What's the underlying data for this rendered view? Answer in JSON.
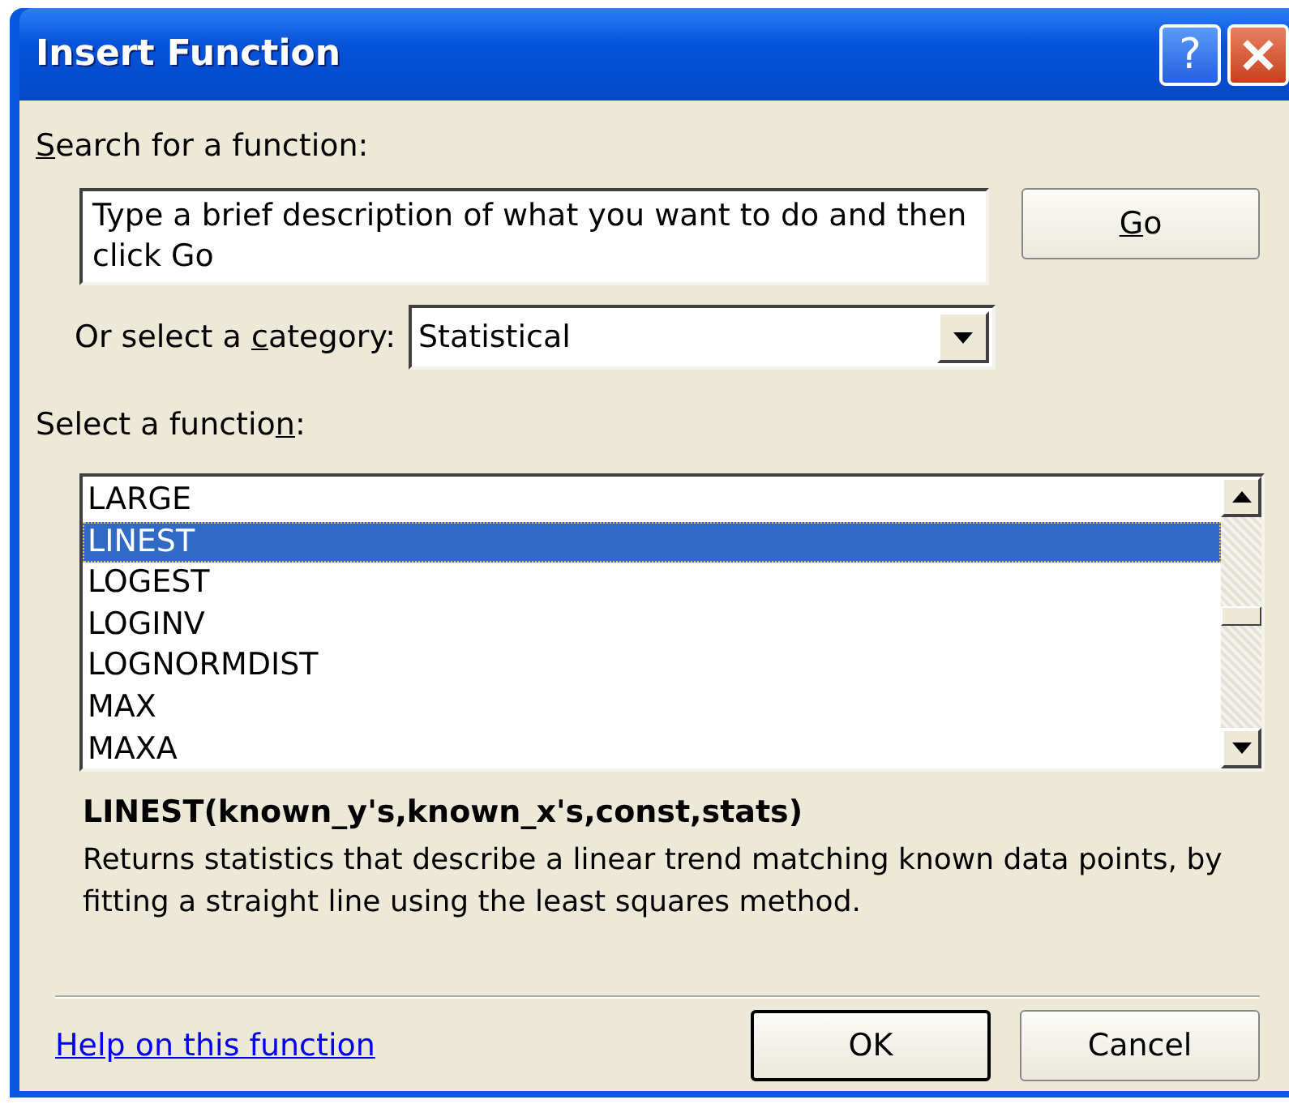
{
  "window": {
    "title": "Insert Function",
    "buttons": [
      {
        "kind": "help",
        "label": "?"
      },
      {
        "kind": "close"
      }
    ]
  },
  "search": {
    "label": [
      {
        "text": "S",
        "underline": true
      },
      {
        "text": "earch for a function:",
        "underline": false
      }
    ],
    "value": "Type a brief description of what you want to do and then click Go",
    "button": [
      {
        "text": "G",
        "underline": true
      },
      {
        "text": "o",
        "underline": false
      }
    ]
  },
  "category": {
    "label": [
      {
        "text": "Or select a ",
        "underline": false
      },
      {
        "text": "c",
        "underline": true
      },
      {
        "text": "ategory:",
        "underline": false
      }
    ],
    "value": "Statistical"
  },
  "functions": {
    "label": [
      {
        "text": "Select a functio",
        "underline": false
      },
      {
        "text": "n",
        "underline": true
      },
      {
        "text": ":",
        "underline": false
      }
    ],
    "items": [
      {
        "name": "LARGE",
        "selected": false
      },
      {
        "name": "LINEST",
        "selected": true
      },
      {
        "name": "LOGEST",
        "selected": false
      },
      {
        "name": "LOGINV",
        "selected": false
      },
      {
        "name": "LOGNORMDIST",
        "selected": false
      },
      {
        "name": "MAX",
        "selected": false
      },
      {
        "name": "MAXA",
        "selected": false
      }
    ]
  },
  "signature": "LINEST(known_y's,known_x's,const,stats)",
  "description": "Returns statistics that describe a linear trend matching known data points, by fitting a straight line using the least squares method.",
  "help_link": "Help on this function",
  "buttons": [
    {
      "label": "OK",
      "default": true
    },
    {
      "label": "Cancel",
      "default": false
    }
  ]
}
